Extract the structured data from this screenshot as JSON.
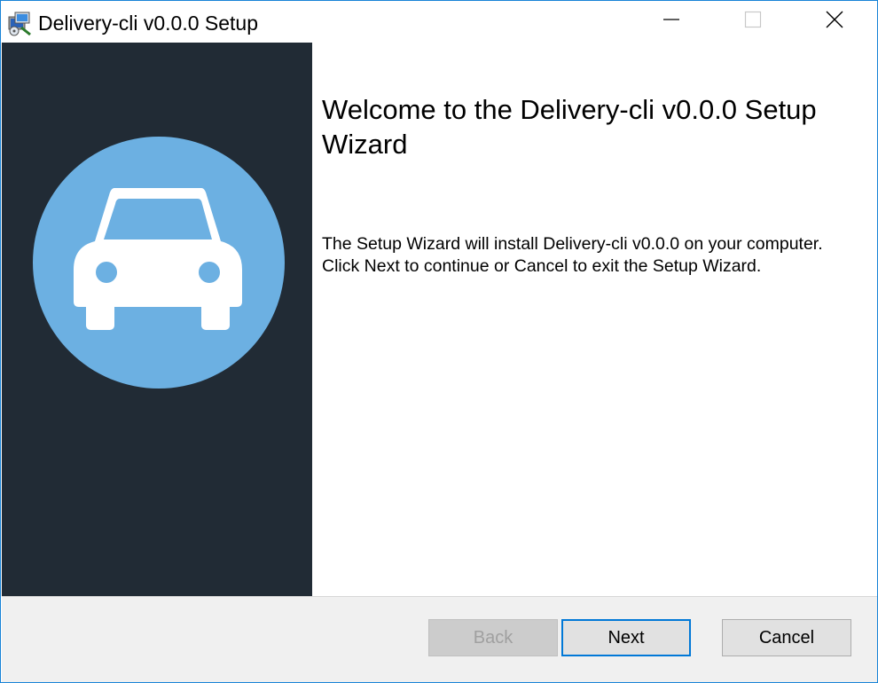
{
  "window": {
    "title": "Delivery-cli v0.0.0 Setup",
    "controls": {
      "minimize_icon": "minimize-icon",
      "maximize_icon": "maximize-icon",
      "close_icon": "close-icon"
    }
  },
  "sidebar": {
    "logo_icon": "car-icon",
    "background_color": "#212b35",
    "logo_circle_color": "#6cb0e2"
  },
  "main": {
    "heading": "Welcome to the Delivery-cli v0.0.0 Setup Wizard",
    "description": "The Setup Wizard will install Delivery-cli v0.0.0 on your computer. Click Next to continue or Cancel to exit the Setup Wizard."
  },
  "footer": {
    "back_label": "Back",
    "next_label": "Next",
    "cancel_label": "Cancel",
    "back_enabled": false
  },
  "colors": {
    "accent": "#0078d7",
    "window_border": "#1883d7",
    "footer_bg": "#f0f0f0"
  }
}
